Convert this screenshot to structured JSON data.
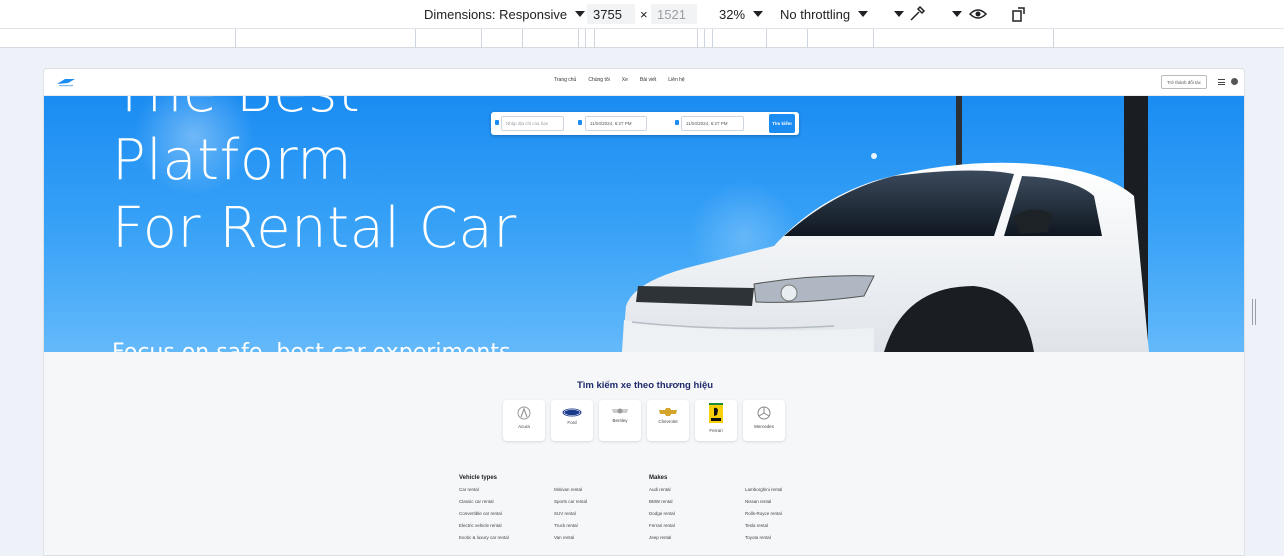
{
  "devtools": {
    "dimensions_label": "Dimensions: Responsive",
    "width_value": "3755",
    "times": "×",
    "height_placeholder": "1521",
    "zoom": "32%",
    "throttling": "No throttling"
  },
  "site": {
    "nav": [
      "Trang chủ",
      "Chúng tôi",
      "Xe",
      "Bài viết",
      "Liên hệ"
    ],
    "login_label": "Trở thành đối tác"
  },
  "hero": {
    "title_lines": [
      "The Best",
      "Platform",
      "For Rental Car"
    ],
    "subtitle": "Focus on safe, best car experiments"
  },
  "search": {
    "location_placeholder": "Nhập địa chỉ của bạn",
    "start_datetime": "11/04/2024, 6:27 PM",
    "end_datetime": "11/04/2024, 6:27 PM",
    "button_label": "Tìm kiếm"
  },
  "brand_section": {
    "title": "Tìm kiếm xe theo thương hiệu",
    "brands": [
      {
        "name": "Acura",
        "icon": "acura-logo-icon"
      },
      {
        "name": "Ford",
        "icon": "ford-logo-icon"
      },
      {
        "name": "Bentley",
        "icon": "bentley-logo-icon"
      },
      {
        "name": "Chevrolet",
        "icon": "chevrolet-logo-icon"
      },
      {
        "name": "Ferrari",
        "icon": "ferrari-logo-icon"
      },
      {
        "name": "Mercedes",
        "icon": "mercedes-logo-icon"
      }
    ]
  },
  "footer_links": {
    "vehicle_types_heading": "Vehicle types",
    "vehicle_types_col1": [
      "Car rental",
      "Classic car rental",
      "Convertible car rental",
      "Electric vehicle rental",
      "Exotic & luxury car rental"
    ],
    "vehicle_types_col2": [
      "Minivan rental",
      "Sports car rental",
      "SUV rental",
      "Truck rental",
      "Van rental"
    ],
    "makes_heading": "Makes",
    "makes_col1": [
      "Audi rental",
      "BMW rental",
      "Dodge rental",
      "Ferrari rental",
      "Jeep rental"
    ],
    "makes_col2": [
      "Lamborghini rental",
      "Nissan rental",
      "Rolls-Royce rental",
      "Tesla rental",
      "Toyota rental"
    ]
  },
  "colors": {
    "accent": "#1a8cf2",
    "heading": "#1f2a6b"
  }
}
